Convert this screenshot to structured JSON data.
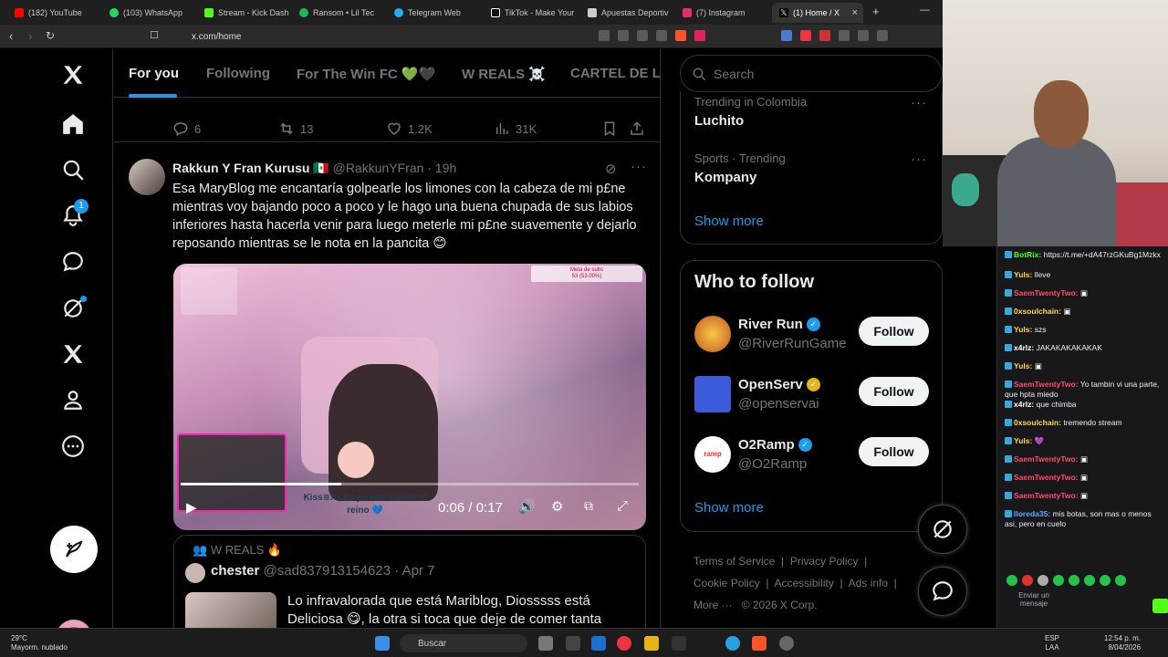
{
  "browser": {
    "tabs": [
      {
        "label": "(182) YouTube",
        "color": "#ff0000"
      },
      {
        "label": "(103) WhatsApp",
        "color": "#25d366"
      },
      {
        "label": "Stream - Kick Dashb",
        "color": "#53fc18"
      },
      {
        "label": "Ransom • Lil Tec",
        "color": "#1db954"
      },
      {
        "label": "Telegram Web",
        "color": "#2aabee"
      },
      {
        "label": "TikTok - Make Your",
        "color": "#ffffff"
      },
      {
        "label": "Apuestas Deportiv",
        "color": "#cccccc"
      },
      {
        "label": "(7) Instagram",
        "color": "#e1306c"
      },
      {
        "label": "(1) Home / X",
        "color": "#ffffff"
      }
    ],
    "new_tab": "+",
    "close_tab": "×",
    "url": "x.com/home"
  },
  "feed_tabs": [
    "For you",
    "Following",
    "For The Win FC 💚🖤",
    "W REALS ☠️",
    "CARTEL DE LC"
  ],
  "prev_post_actions": {
    "replies": "6",
    "reposts": "13",
    "likes": "1.2K",
    "views": "31K"
  },
  "post": {
    "name": "Rakkun Y Fran Kurusu 🇲🇽",
    "handle": "@RakkunYFran",
    "time": "· 19h",
    "text": "Esa MaryBlog me encantaría golpearle los limones con la cabeza de mi p£ne mientras voy bajando poco a poco y le hago una buena chupada de sus labios inferiores hasta hacerla venir para luego meterle mi p£ne suavemente y dejarlo reposando mientras se le nota en la pancita 😊",
    "video": {
      "time": "0:06 / 0:17",
      "overlay_goal": "53 (53.00%)",
      "overlay_goal_title": "Meta de subs",
      "overlay_caption": "Kiss≋Xx ha jurado lealtad al reino 💙",
      "progress": 0.35
    }
  },
  "quote": {
    "context": "W REALS 🔥",
    "name": "chester",
    "handle": "@sad837913154623",
    "date": "· Apr 7",
    "text": "Lo infravalorada que está Mariblog, Diosssss está Deliciosa 😋, la otra si toca que deje de comer tanta"
  },
  "search": {
    "placeholder": "Search"
  },
  "trends": [
    {
      "meta": "Trending in Colombia",
      "name": "Luchito"
    },
    {
      "meta": "Sports · Trending",
      "name": "Kompany"
    }
  ],
  "trends_show_more": "Show more",
  "who_to_follow": {
    "title": "Who to follow",
    "accounts": [
      {
        "name": "River Run",
        "handle": "@RiverRunGame",
        "badge_color": "#1d9bf0",
        "follow": "Follow"
      },
      {
        "name": "OpenServ",
        "handle": "@openservai",
        "badge_color": "#e2b719",
        "follow": "Follow"
      },
      {
        "name": "O2Ramp",
        "handle": "@O2Ramp",
        "badge_color": "#1d9bf0",
        "follow": "Follow"
      }
    ],
    "show_more": "Show more"
  },
  "footer": {
    "links": [
      "Terms of Service",
      "Privacy Policy",
      "Cookie Policy",
      "Accessibility",
      "Ads info",
      "More ···"
    ],
    "copyright": "© 2026 X Corp."
  },
  "notification_count": "1",
  "chat": {
    "messages": [
      {
        "user": "BotRix:",
        "color": "#53fc18",
        "text": "https://t.me/+dA47rzGKuBg1Mzkx"
      },
      {
        "user": "Yuls:",
        "color": "#ffd84d",
        "text": "lleve"
      },
      {
        "user": "SaemTwentyTwo:",
        "color": "#ff4d6d",
        "text": "▣"
      },
      {
        "user": "0xsoulchain:",
        "color": "#ffd84d",
        "text": "▣"
      },
      {
        "user": "Yuls:",
        "color": "#ffd84d",
        "text": "szs"
      },
      {
        "user": "x4rlz:",
        "color": "#ffffff",
        "text": "JAKAKAKAKAKAK"
      },
      {
        "user": "Yuls:",
        "color": "#ffd84d",
        "text": "▣"
      },
      {
        "user": "SaemTwentyTwo:",
        "color": "#ff4d6d",
        "text": "Yo tambin vi una parte, que hpta miedo"
      },
      {
        "user": "x4rlz:",
        "color": "#ffffff",
        "text": "que chimba"
      },
      {
        "user": "0xsoulchain:",
        "color": "#ffd84d",
        "text": "tremendo stream"
      },
      {
        "user": "Yuls:",
        "color": "#ffd84d",
        "text": "💜"
      },
      {
        "user": "SaemTwentyTwo:",
        "color": "#ff4d6d",
        "text": "▣"
      },
      {
        "user": "SaemTwentyTwo:",
        "color": "#ff4d6d",
        "text": "▣"
      },
      {
        "user": "SaemTwentyTwo:",
        "color": "#ff4d6d",
        "text": "▣"
      },
      {
        "user": "lloreda35:",
        "color": "#62a8ff",
        "text": "mis botas, son mas o menos asi, pero en cuelo"
      }
    ],
    "input_placeholder": "Enviar un mensaje"
  },
  "taskbar": {
    "weather_temp": "29°C",
    "weather_desc": "Mayorm. nublado",
    "search": "Buscar",
    "lang": "ESP",
    "lang2": "LAA",
    "time": "12:54 p. m.",
    "date": "8/04/2026"
  }
}
